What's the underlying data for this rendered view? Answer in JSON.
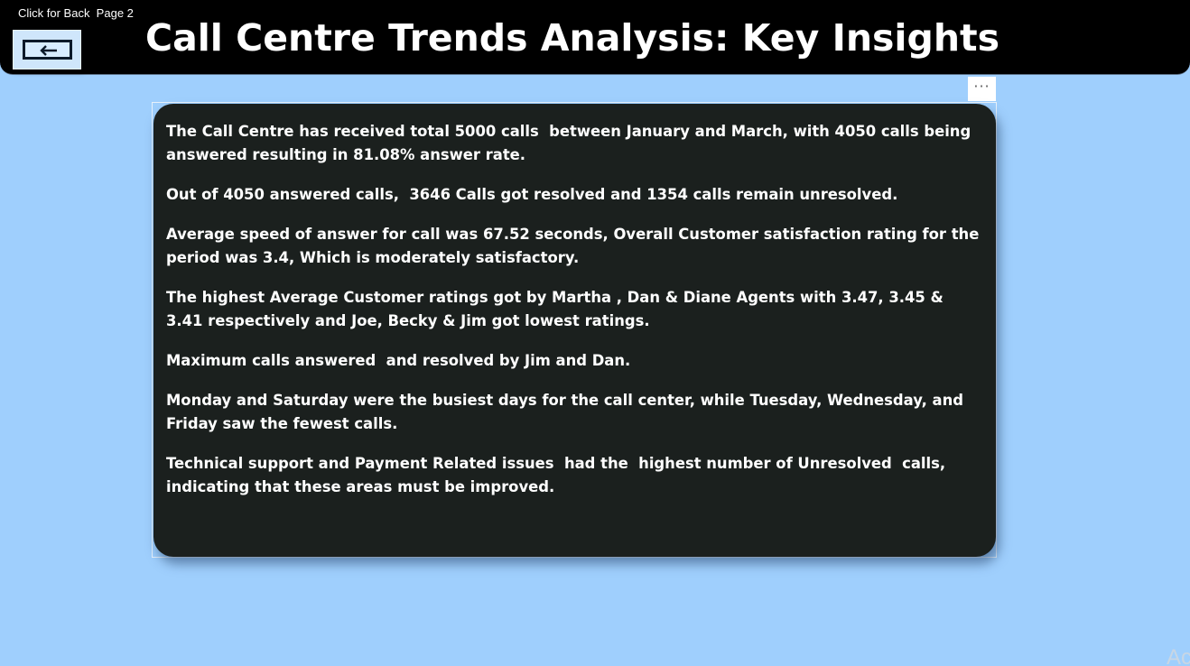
{
  "header": {
    "back_hint": "Click for Back  Page 2",
    "title": "Call Centre Trends Analysis: Key Insights",
    "back_button_icon": "left-arrow-icon"
  },
  "visual_header": {
    "more_options_label": "···"
  },
  "insights": [
    "The Call Centre has received total 5000 calls  between January and March, with 4050 calls being answered resulting in 81.08% answer rate.",
    "Out of 4050 answered calls,  3646 Calls got resolved and 1354 calls remain unresolved.",
    "Average speed of answer for call was 67.52 seconds, Overall Customer satisfaction rating for the period was 3.4, Which is moderately satisfactory.",
    "The highest Average Customer ratings got by Martha , Dan & Diane Agents with 3.47, 3.45 & 3.41 respectively and Joe, Becky & Jim got lowest ratings.",
    "Maximum calls answered  and resolved by Jim and Dan.",
    "Monday and Saturday were the busiest days for the call center, while Tuesday, Wednesday, and Friday saw the fewest calls.",
    "Technical support and Payment Related issues  had the  highest number of Unresolved  calls, indicating that these areas must be improved."
  ],
  "watermark": "Ac",
  "colors": {
    "background": "#9fcffd",
    "header": "#000000",
    "card": "#1b201e",
    "text": "#ffffff"
  }
}
